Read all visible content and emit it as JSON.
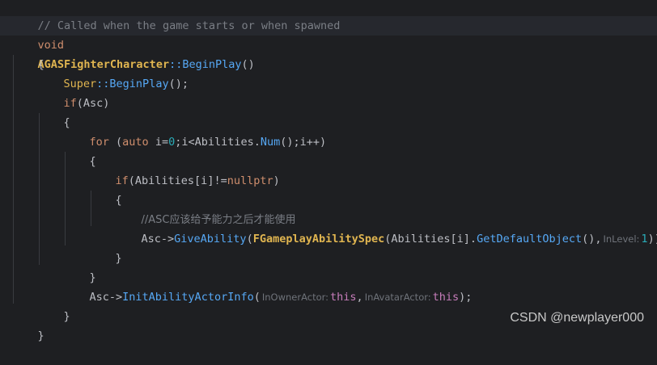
{
  "editor": {
    "language": "C++",
    "theme_colors": {
      "background": "#1e1f22",
      "keyword": "#cf8e6d",
      "function": "#56a8f5",
      "class": "#e0b550",
      "number": "#2aacb8",
      "macro": "#c77dbb",
      "comment": "#7a7e85"
    },
    "code": {
      "header_comment": "// Called when the game starts or when spawned",
      "kw_void": "void",
      "class_name": "AGASFighterCharacter",
      "scope": "::",
      "method_begin_play": "BeginPlay",
      "parens_empty": "()",
      "brace_open": "{",
      "brace_close": "}",
      "super_kw": "Super",
      "call_semicolon": "();",
      "kw_if": "if",
      "if_asc_cond": "(Asc)",
      "kw_for": "for",
      "for_open": " (",
      "kw_auto": "auto",
      "for_init_var": " i=",
      "num_zero": "0",
      "for_cond_start": ";i<Abilities.",
      "method_num": "Num",
      "for_tail": "();i++)",
      "if_null_open": "(Abilities[i]!=",
      "kw_nullptr": "nullptr",
      "paren_close": ")",
      "cjk_comment": "//ASC应该给予能力之后才能使用",
      "asc_arrow": "Asc->",
      "method_give_ability": "GiveAbility",
      "paren_open": "(",
      "type_spec": "FGameplayAbilitySpec",
      "spec_arg_open": "(Abilities[i].",
      "method_get_default_object": "GetDefaultObject",
      "call_comma": "(),",
      "hint_in_level": "InLevel:",
      "num_one": "1",
      "give_tail": "));",
      "method_init_actor_info": "InitAbilityActorInfo",
      "hint_owner_actor": "InOwnerActor:",
      "kw_this": "this",
      "comma": ",",
      "hint_avatar_actor": "InAvatarActor:",
      "init_tail": ");"
    }
  },
  "watermark": "CSDN @newplayer000"
}
